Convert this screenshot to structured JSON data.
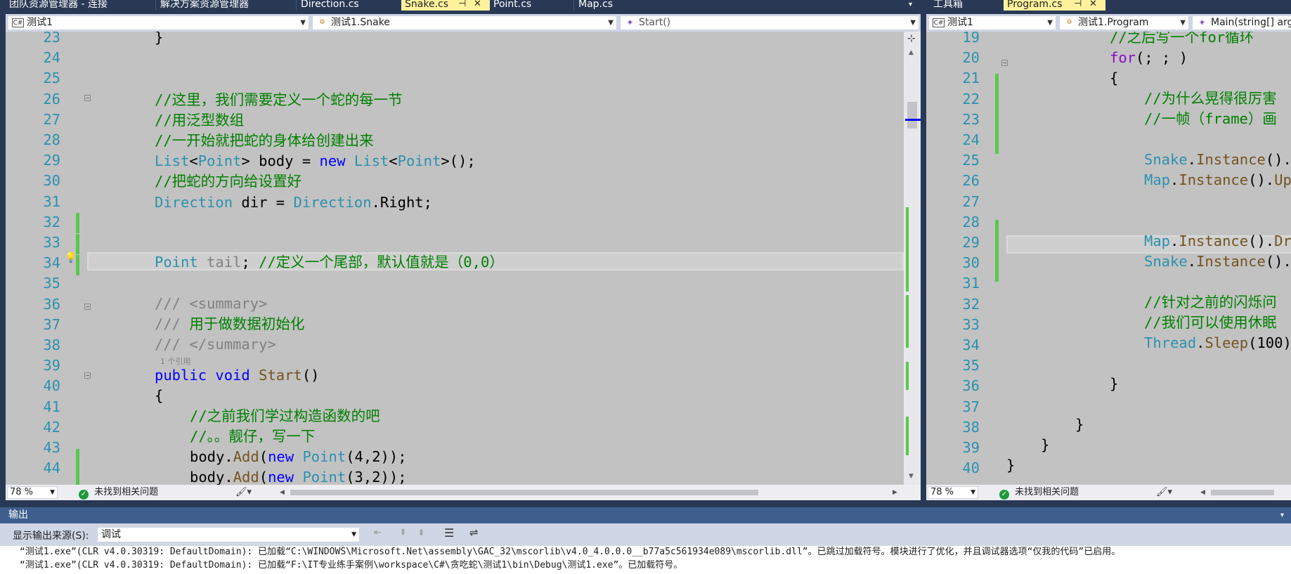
{
  "left_tabs": [
    {
      "label": "团队资源管理器 - 连接",
      "active": false
    },
    {
      "label": "解决方案资源管理器",
      "active": false
    },
    {
      "label": "Direction.cs",
      "active": false
    },
    {
      "label": "Snake.cs",
      "active": true
    },
    {
      "label": "Point.cs",
      "active": false
    },
    {
      "label": "Map.cs",
      "active": false
    }
  ],
  "right_tabs": [
    {
      "label": "工具箱",
      "active": false
    },
    {
      "label": "Program.cs",
      "active": true
    }
  ],
  "left_nav": {
    "project": "测试1",
    "class": "测试1.Snake",
    "member": "Start()"
  },
  "right_nav": {
    "project": "测试1",
    "class": "测试1.Program",
    "member": "Main(string[] arg"
  },
  "left_code": {
    "line_numbers": [
      "23",
      "24",
      "25",
      "26",
      "27",
      "28",
      "29",
      "30",
      "31",
      "32",
      "33",
      "34",
      "35",
      "36",
      "37",
      "38",
      "39",
      "40",
      "41",
      "42",
      "43",
      "44"
    ],
    "ref_hint": "1 个引用"
  },
  "right_code": {
    "line_numbers": [
      "19",
      "20",
      "21",
      "22",
      "23",
      "24",
      "25",
      "26",
      "27",
      "28",
      "29",
      "30",
      "31",
      "32",
      "33",
      "34",
      "35",
      "36",
      "37",
      "38",
      "39",
      "40"
    ]
  },
  "left_status": {
    "zoom": "78 %",
    "issues": "未找到相关问题"
  },
  "right_status": {
    "zoom": "78 %",
    "issues": "未找到相关问题"
  },
  "output": {
    "title": "输出",
    "source_label": "显示输出来源(S):",
    "source_value": "调试",
    "lines": [
      "“测试1.exe”(CLR v4.0.30319: DefaultDomain): 已加载“C:\\WINDOWS\\Microsoft.Net\\assembly\\GAC_32\\mscorlib\\v4.0_4.0.0.0__b77a5c561934e089\\mscorlib.dll”。已跳过加载符号。模块进行了优化，并且调试器选项“仅我的代码”已启用。",
      "“测试1.exe”(CLR v4.0.30319: DefaultDomain): 已加载“F:\\IT专业练手案例\\workspace\\C#\\贪吃蛇\\测试1\\bin\\Debug\\测试1.exe”。已加载符号。"
    ]
  },
  "colors": {
    "accent_tab": "#fff29d",
    "chrome": "#293955",
    "editor_bg": "#c2c2c2",
    "comment": "#008000",
    "keyword": "#0000ff",
    "type": "#2b91af",
    "change_bar": "#57c84d"
  }
}
